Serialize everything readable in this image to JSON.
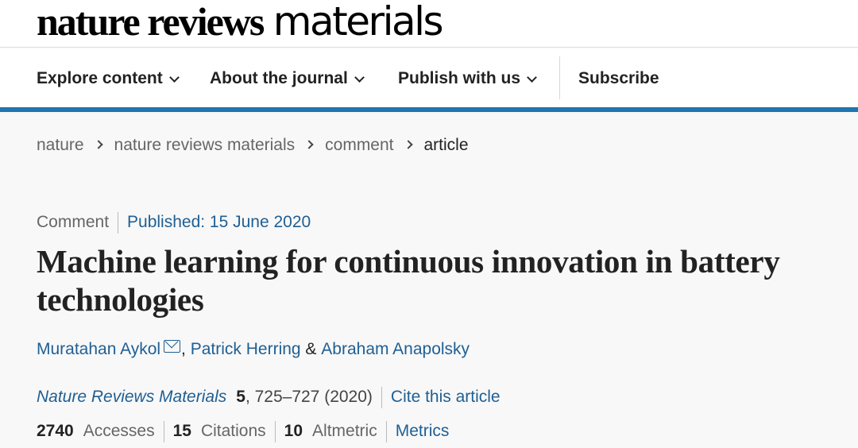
{
  "brand": {
    "name_bold": "nature reviews",
    "name_light": "materials"
  },
  "nav": {
    "items": [
      {
        "label": "Explore content",
        "has_dropdown": true
      },
      {
        "label": "About the journal",
        "has_dropdown": true
      },
      {
        "label": "Publish with us",
        "has_dropdown": true
      }
    ],
    "subscribe_label": "Subscribe",
    "accent_color": "#1f75b0"
  },
  "breadcrumb": [
    {
      "label": "nature"
    },
    {
      "label": "nature reviews materials"
    },
    {
      "label": "comment"
    },
    {
      "label": "article"
    }
  ],
  "article": {
    "type": "Comment",
    "published": "Published: 15 June 2020",
    "title": "Machine learning for continuous innovation in battery technologies",
    "authors": {
      "first": "Muratahan Aykol",
      "separator1": ", ",
      "second": "Patrick Herring",
      "separator2": " & ",
      "third": "Abraham Anapolsky"
    },
    "citation": {
      "journal": "Nature Reviews Materials",
      "volume": "5",
      "pages": ", 725–727 (2020)",
      "cite_label": "Cite this article"
    },
    "metrics": {
      "accesses_value": "2740",
      "accesses_label": "Accesses",
      "citations_value": "15",
      "citations_label": "Citations",
      "altmetric_value": "10",
      "altmetric_label": "Altmetric",
      "metrics_link": "Metrics"
    }
  },
  "colors": {
    "link": "#1f5f94",
    "text": "#222222",
    "muted": "#666666",
    "background": "#f8f8f8"
  }
}
